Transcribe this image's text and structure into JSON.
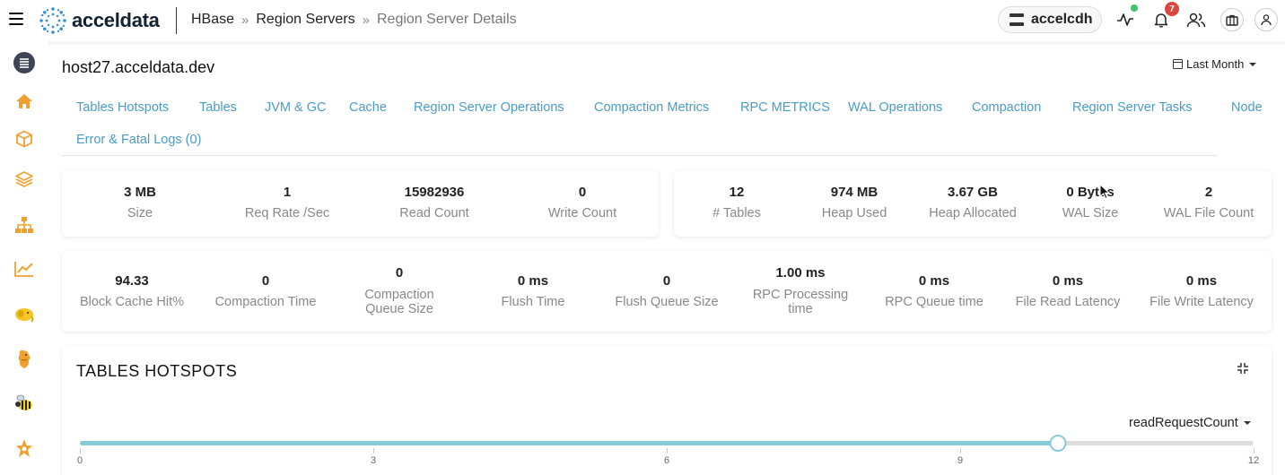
{
  "header": {
    "logo_text": "acceldata",
    "breadcrumb": [
      "HBase",
      "Region Servers",
      "Region Server Details"
    ],
    "breadcrumb_sep": "»",
    "cluster": "accelcdh",
    "notification_count": "7",
    "icons": [
      "menu-icon",
      "server-icon",
      "activity-icon",
      "bell-icon",
      "users-icon",
      "briefcase-icon",
      "user-icon"
    ],
    "status_color": "#3ec46d",
    "badge_color": "#d9473f"
  },
  "sidebar": {
    "items": [
      "list-icon",
      "home-icon",
      "cube-icon",
      "layers-icon",
      "sitemap-icon",
      "chart-line-icon",
      "hadoop-elephant-icon",
      "hive-icon",
      "hbase-bee-icon",
      "spark-icon"
    ],
    "accent": "#f0a030"
  },
  "page": {
    "host": "host27.acceldata.dev",
    "range_label": "Last Month"
  },
  "tabs": [
    "Tables Hotspots",
    "Tables",
    "JVM & GC",
    "Cache",
    "Region Server Operations",
    "Compaction Metrics",
    "RPC METRICS",
    "WAL Operations",
    "Compaction",
    "Region Server Tasks",
    "Node",
    "Error & Fatal Logs (0)"
  ],
  "metrics_row1_left": [
    {
      "value": "3 MB",
      "label": "Size"
    },
    {
      "value": "1",
      "label": "Req Rate /Sec"
    },
    {
      "value": "15982936",
      "label": "Read Count"
    },
    {
      "value": "0",
      "label": "Write Count"
    }
  ],
  "metrics_row1_right": [
    {
      "value": "12",
      "label": "# Tables"
    },
    {
      "value": "974 MB",
      "label": "Heap Used"
    },
    {
      "value": "3.67 GB",
      "label": "Heap Allocated"
    },
    {
      "value": "0 Bytes",
      "label": "WAL Size"
    },
    {
      "value": "2",
      "label": "WAL File Count"
    }
  ],
  "metrics_row2": [
    {
      "value": "94.33",
      "label": "Block Cache Hit%"
    },
    {
      "value": "0",
      "label": "Compaction Time"
    },
    {
      "value": "0",
      "label": "Compaction Queue Size"
    },
    {
      "value": "0 ms",
      "label": "Flush Time"
    },
    {
      "value": "0",
      "label": "Flush Queue Size"
    },
    {
      "value": "1.00 ms",
      "label": "RPC Processing time"
    },
    {
      "value": "0 ms",
      "label": "RPC Queue time"
    },
    {
      "value": "0 ms",
      "label": "File Read Latency"
    },
    {
      "value": "0 ms",
      "label": "File Write Latency"
    }
  ],
  "hotspots": {
    "title": "TABLES HOTSPOTS",
    "metric": "readRequestCount",
    "slider": {
      "min": 0,
      "max": 12,
      "value": 10,
      "ticks": [
        "0",
        "3",
        "6",
        "9",
        "12"
      ]
    },
    "slider_color": "#85ccd8"
  }
}
